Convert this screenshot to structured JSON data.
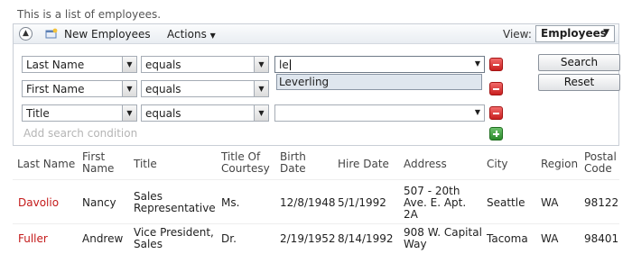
{
  "description": "This is a list of employees.",
  "toolbar": {
    "new_label": "New Employees",
    "actions_label": "Actions",
    "view_label": "View:",
    "view_value": "Employees"
  },
  "search": {
    "conditions": [
      {
        "field": "Last Name",
        "operator": "equals",
        "value": "le"
      },
      {
        "field": "First Name",
        "operator": "equals",
        "value": ""
      },
      {
        "field": "Title",
        "operator": "equals",
        "value": ""
      }
    ],
    "suggestion": "Leverling",
    "add_condition": "Add search condition",
    "search_button": "Search",
    "reset_button": "Reset"
  },
  "grid": {
    "columns": [
      "Last Name",
      "First Name",
      "Title",
      "Title Of Courtesy",
      "Birth Date",
      "Hire Date",
      "Address",
      "City",
      "Region",
      "Postal Code"
    ],
    "rows": [
      [
        "Davolio",
        "Nancy",
        "Sales Representative",
        "Ms.",
        "12/8/1948",
        "5/1/1992",
        "507 - 20th Ave. E. Apt. 2A",
        "Seattle",
        "WA",
        "98122"
      ],
      [
        "Fuller",
        "Andrew",
        "Vice President, Sales",
        "Dr.",
        "2/19/1952",
        "8/14/1992",
        "908 W. Capital Way",
        "Tacoma",
        "WA",
        "98401"
      ]
    ]
  },
  "colors": {
    "link": "#c41a1a",
    "remove": "#d62b2b",
    "add": "#3d9a3d"
  }
}
